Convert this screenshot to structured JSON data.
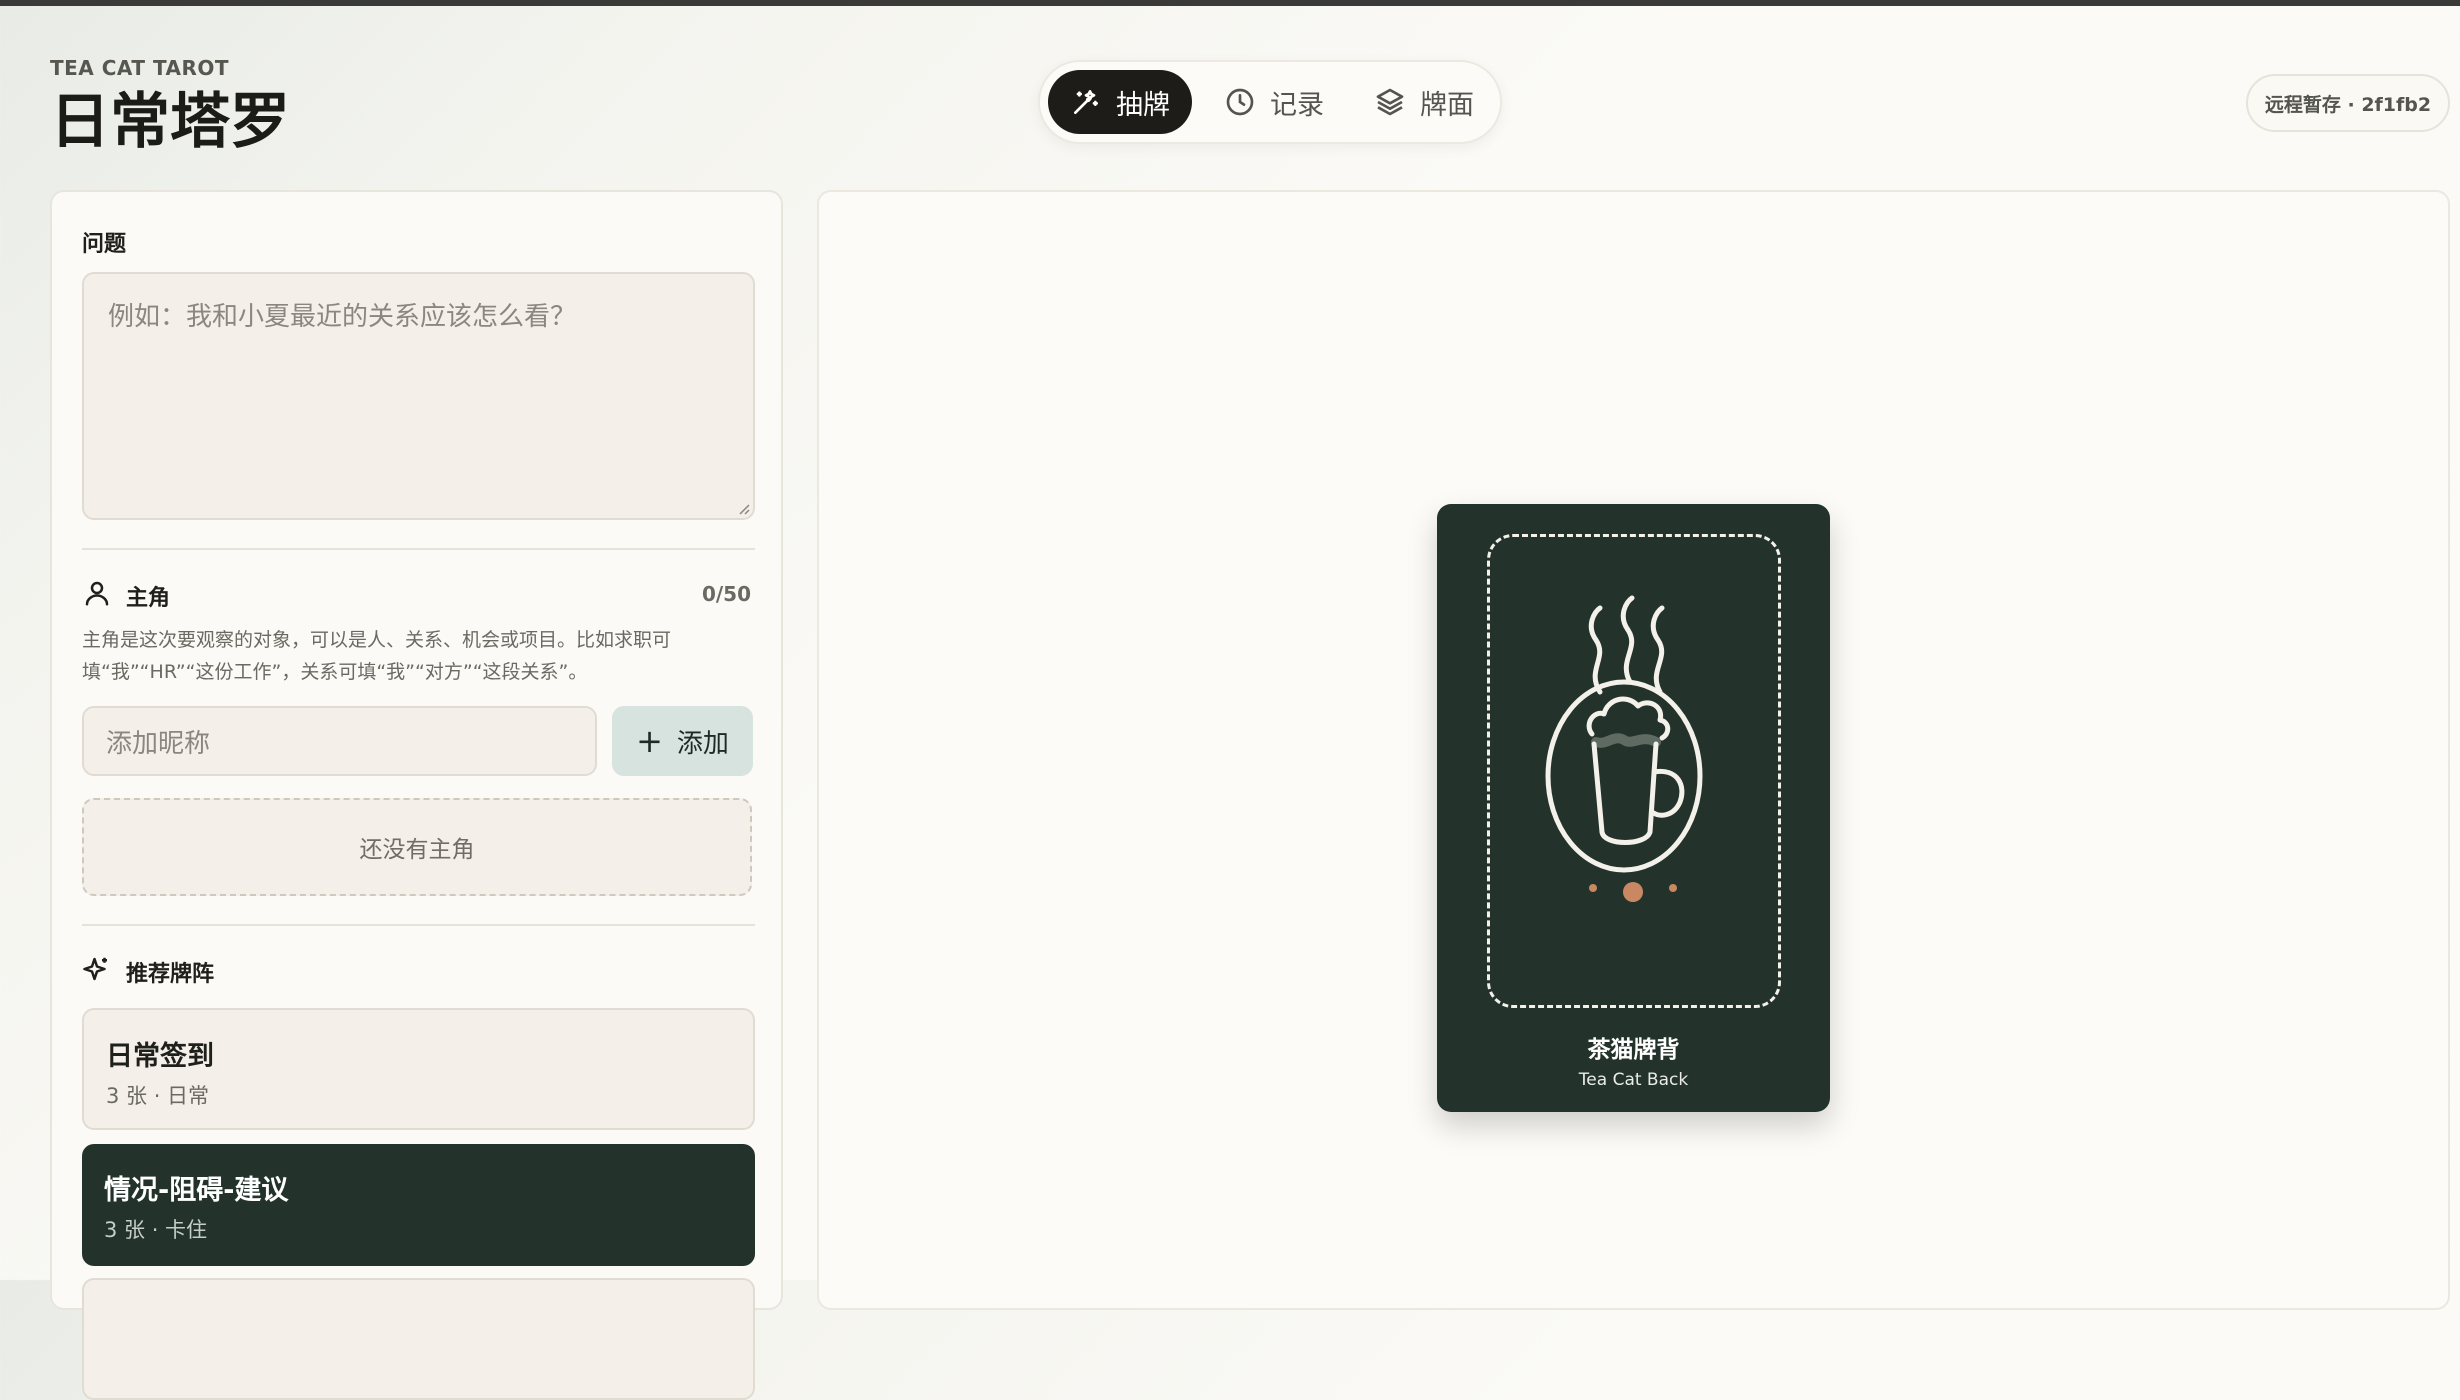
{
  "header": {
    "brand": "TEA CAT TAROT",
    "title": "日常塔罗",
    "remote_status": "远程暂存 · 2f1fb2"
  },
  "nav": {
    "tabs": [
      {
        "label": "抽牌",
        "icon": "magic-wand-icon",
        "active": true
      },
      {
        "label": "记录",
        "icon": "clock-icon",
        "active": false
      },
      {
        "label": "牌面",
        "icon": "layers-icon",
        "active": false
      }
    ]
  },
  "question": {
    "label": "问题",
    "placeholder": "例如：我和小夏最近的关系应该怎么看？",
    "value": ""
  },
  "protagonist": {
    "label": "主角",
    "icon": "person-icon",
    "count": "0/50",
    "description": "主角是这次要观察的对象，可以是人、关系、机会或项目。比如求职可填“我”“HR”“这份工作”，关系可填“我”“对方”“这段关系”。",
    "nickname_placeholder": "添加昵称",
    "add_label": "添加",
    "empty_text": "还没有主角"
  },
  "spreads": {
    "label": "推荐牌阵",
    "icon": "sparkle-icon",
    "items": [
      {
        "name": "日常签到",
        "meta": "3 张 · 日常",
        "selected": false
      },
      {
        "name": "情况-阻碍-建议",
        "meta": "3 张 · 卡住",
        "selected": true
      }
    ]
  },
  "card": {
    "title": "茶猫牌背",
    "subtitle": "Tea Cat Back",
    "icon": "tea-cat-cup-icon"
  },
  "colors": {
    "dark_green": "#23332c",
    "accent_copper": "#c98862",
    "panel_bg": "#fbfaf6",
    "input_bg": "#f4f0e9",
    "add_button_bg": "#d6e3de"
  }
}
